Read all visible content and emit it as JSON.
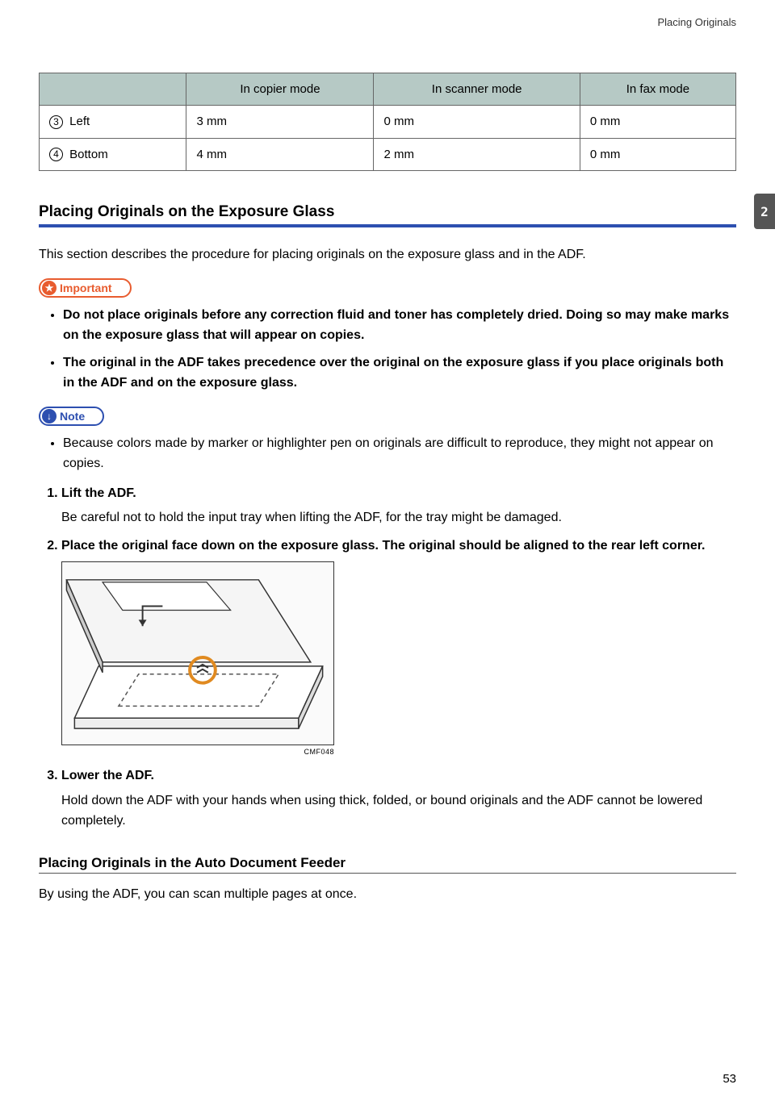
{
  "running_header": "Placing Originals",
  "chapter_tab": "2",
  "page_number": "53",
  "table": {
    "headers": [
      "",
      "In copier mode",
      "In scanner mode",
      "In fax mode"
    ],
    "rows": [
      {
        "num": "3",
        "label": " Left",
        "copier": "3 mm",
        "scanner": "0 mm",
        "fax": "0 mm"
      },
      {
        "num": "4",
        "label": " Bottom",
        "copier": "4 mm",
        "scanner": "2 mm",
        "fax": "0 mm"
      }
    ]
  },
  "section1": {
    "title": "Placing Originals on the Exposure Glass",
    "intro": "This section describes the procedure for placing originals on the exposure glass and in the ADF.",
    "important_label": "Important",
    "important_bullets": [
      "Do not place originals before any correction fluid and toner has completely dried. Doing so may make marks on the exposure glass that will appear on copies.",
      "The original in the ADF takes precedence over the original on the exposure glass if you place originals both in the ADF and on the exposure glass."
    ],
    "note_label": "Note",
    "note_bullets": [
      "Because colors made by marker or highlighter pen on originals are difficult to reproduce, they might not appear on copies."
    ],
    "steps": [
      {
        "title": "Lift the ADF.",
        "body": "Be careful not to hold the input tray when lifting the ADF, for the tray might be damaged."
      },
      {
        "title": "Place the original face down on the exposure glass. The original should be aligned to the rear left corner.",
        "body": ""
      },
      {
        "title": "Lower the ADF.",
        "body": "Hold down the ADF with your hands when using thick, folded, or bound originals and the ADF cannot be lowered completely."
      }
    ],
    "figure_id": "CMF048"
  },
  "section2": {
    "title": "Placing Originals in the Auto Document Feeder",
    "intro": "By using the ADF, you can scan multiple pages at once."
  }
}
